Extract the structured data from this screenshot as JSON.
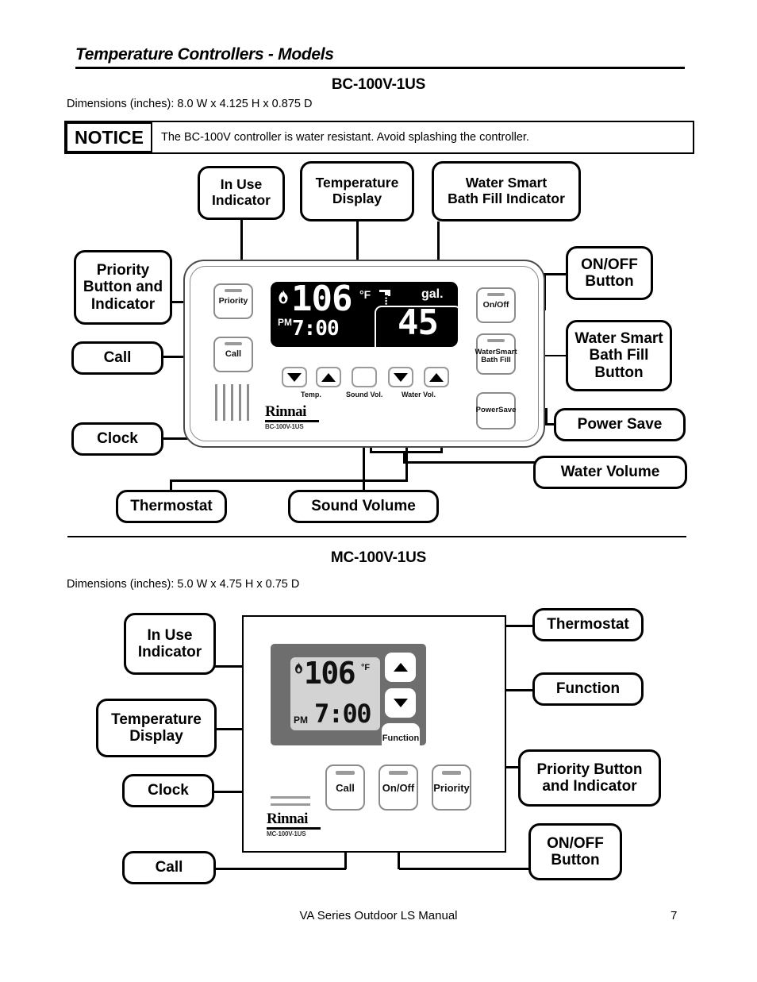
{
  "header": {
    "doc_title": "Temperature Controllers - Models"
  },
  "bc_section": {
    "model": "BC-100V-1US",
    "dimensions": "Dimensions (inches):  8.0 W x 4.125 H x 0.875 D",
    "notice": {
      "label": "NOTICE",
      "text": "The BC-100V controller is water resistant.  Avoid splashing the controller."
    },
    "callouts": {
      "in_use_indicator": "In Use\nIndicator",
      "temperature_display": "Temperature\nDisplay",
      "water_smart_indicator": "Water Smart\nBath Fill Indicator",
      "priority_button": "Priority\nButton and\nIndicator",
      "call": "Call",
      "clock": "Clock",
      "thermostat": "Thermostat",
      "sound_volume": "Sound Volume",
      "water_volume": "Water Volume",
      "on_off_button": "ON/OFF\nButton",
      "water_smart_button": "Water Smart\nBath Fill\nButton",
      "power_save": "Power Save"
    },
    "panel": {
      "priority_label": "Priority",
      "call_label": "Call",
      "on_off_label": "On/Off",
      "water_smart_label": "WaterSmart\nBath Fill",
      "power_save_label": "PowerSave",
      "temp_label": "Temp.",
      "sound_label": "Sound Vol.",
      "water_label": "Water Vol.",
      "brand": "Rinnai",
      "model_text": "BC-100V-1US"
    },
    "lcd": {
      "temperature": "106",
      "temp_unit": "°F",
      "meridiem": "PM",
      "clock": "7:00",
      "gallons_unit": "gal.",
      "gallons": "45"
    }
  },
  "mc_section": {
    "model": "MC-100V-1US",
    "dimensions": "Dimensions (inches):  5.0 W x 4.75 H x 0.75 D",
    "callouts": {
      "in_use_indicator": "In Use\nIndicator",
      "temperature_display": "Temperature\nDisplay",
      "clock": "Clock",
      "call": "Call",
      "thermostat": "Thermostat",
      "function": "Function",
      "priority_button": "Priority Button\nand Indicator",
      "on_off_button": "ON/OFF\nButton"
    },
    "panel": {
      "function_label": "Function",
      "call_label": "Call",
      "on_off_label": "On/Off",
      "priority_label": "Priority",
      "brand": "Rinnai",
      "model_text": "MC-100V-1US"
    },
    "lcd": {
      "temperature": "106",
      "temp_unit": "°F",
      "meridiem": "PM",
      "clock": "7:00"
    }
  },
  "footer": {
    "manual": "VA Series Outdoor LS Manual",
    "page": "7"
  }
}
